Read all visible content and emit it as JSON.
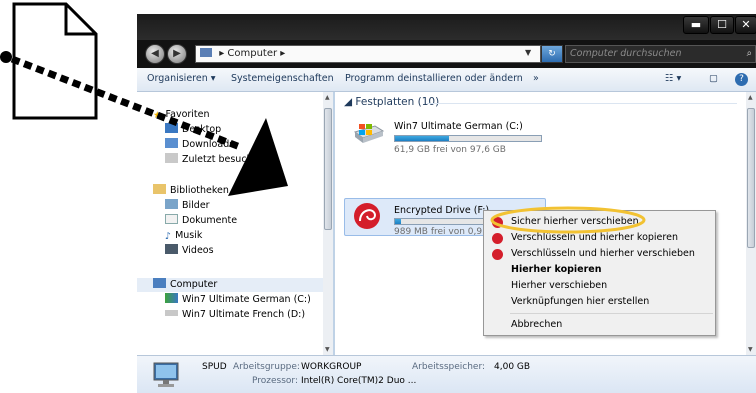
{
  "window": {
    "address": "Computer",
    "search_placeholder": "Computer durchsuchen"
  },
  "toolbar": {
    "organize": "Organisieren ▾",
    "system_properties": "Systemeigenschaften",
    "uninstall": "Programm deinstallieren oder ändern",
    "more": "»"
  },
  "sidebar": {
    "favorites": {
      "label": "Favoriten",
      "items": [
        "Desktop",
        "Downloads",
        "Zuletzt besucht"
      ]
    },
    "libraries": {
      "label": "Bibliotheken",
      "items": [
        "Bilder",
        "Dokumente",
        "Musik",
        "Videos"
      ]
    },
    "computer": {
      "label": "Computer",
      "items": [
        "Win7 Ultimate German (C:)",
        "Win7 Ultimate French (D:)"
      ]
    }
  },
  "content": {
    "group_title": "Festplatten (10)",
    "drives": [
      {
        "name": "Win7 Ultimate German (C:)",
        "free": "61,9 GB frei von 97,6 GB",
        "used_fraction": 0.37
      },
      {
        "name": "Encrypted Drive (F:)",
        "free": "989 MB frei von 0,9…",
        "used_fraction": 0.04
      }
    ]
  },
  "context_menu": {
    "items": [
      "Sicher hierher verschieben",
      "Verschlüsseln und hierher kopieren",
      "Verschlüsseln und hierher verschieben",
      "Hierher kopieren",
      "Hierher verschieben",
      "Verknüpfungen hier erstellen",
      "Abbrechen"
    ]
  },
  "status_bar": {
    "computer_name": "SPUD",
    "workgroup_label": "Arbeitsgruppe:",
    "workgroup": "WORKGROUP",
    "memory_label": "Arbeitsspeicher:",
    "memory": "4,00 GB",
    "processor_label": "Prozessor:",
    "processor": "Intel(R) Core(TM)2 Duo ..."
  },
  "colors": {
    "accent": "#1e395b",
    "highlight_ring": "#f2c232",
    "encrypt_icon": "#d41e2b",
    "drive_bar": "#2a8fd0"
  }
}
